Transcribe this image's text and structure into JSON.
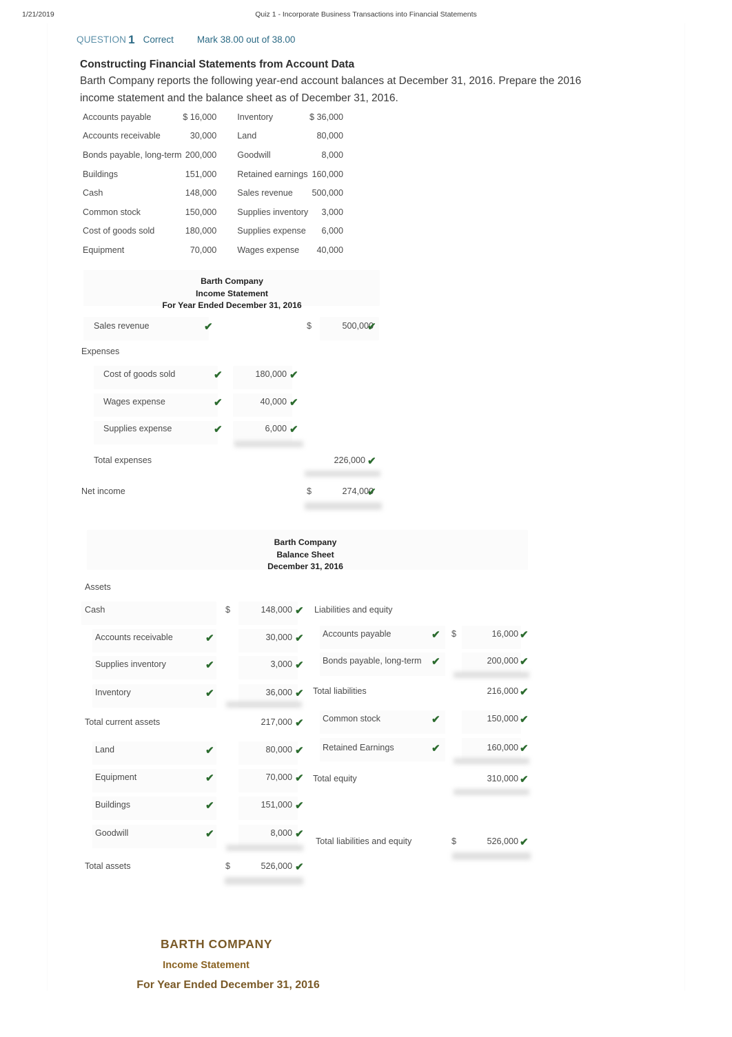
{
  "print_header": {
    "date": "1/21/2019",
    "title": "Quiz 1 - Incorporate Business Transactions into Financial Statements"
  },
  "question_meta": {
    "question_label": "QUESTION",
    "question_number": "1",
    "state": "Correct",
    "mark": "Mark 38.00 out of 38.00"
  },
  "prompt": {
    "title": "Constructing Financial Statements from Account Data",
    "body": "Barth Company reports the following year-end account balances at December 31, 2016. Prepare the 2016 income statement and the balance sheet as of December 31, 2016."
  },
  "account_data": {
    "rows": [
      {
        "label": "Accounts payable",
        "value": "$ 16,000",
        "label2": "Inventory",
        "value2": "$ 36,000"
      },
      {
        "label": "Accounts receivable",
        "value": "30,000",
        "label2": "Land",
        "value2": "80,000"
      },
      {
        "label": "Bonds payable, long-term",
        "value": "200,000",
        "label2": "Goodwill",
        "value2": "8,000"
      },
      {
        "label": "Buildings",
        "value": "151,000",
        "label2": "Retained earnings",
        "value2": "160,000"
      },
      {
        "label": "Cash",
        "value": "148,000",
        "label2": "Sales revenue",
        "value2": "500,000"
      },
      {
        "label": "Common stock",
        "value": "150,000",
        "label2": "Supplies inventory",
        "value2": "3,000"
      },
      {
        "label": "Cost of goods sold",
        "value": "180,000",
        "label2": "Supplies expense",
        "value2": "6,000"
      },
      {
        "label": "Equipment",
        "value": "70,000",
        "label2": "Wages expense",
        "value2": "40,000"
      }
    ]
  },
  "income_statement": {
    "company": "Barth Company",
    "title": "Income Statement",
    "period": "For Year Ended December 31, 2016",
    "sales_revenue_label": "Sales revenue",
    "sales_revenue_dollar": "$",
    "sales_revenue_value": "500,000",
    "expenses_header": "Expenses",
    "expense_rows": [
      {
        "label": "Cost of goods sold",
        "value": "180,000"
      },
      {
        "label": "Wages expense",
        "value": "40,000"
      },
      {
        "label": "Supplies expense",
        "value": "6,000"
      }
    ],
    "total_expenses_label": "Total expenses",
    "total_expenses_value": "226,000",
    "net_income_label": "Net income",
    "net_income_dollar": "$",
    "net_income_value": "274,000"
  },
  "balance_sheet": {
    "company": "Barth Company",
    "title": "Balance Sheet",
    "period": "December 31, 2016",
    "assets_header": "Assets",
    "cash_label": "Cash",
    "cash_dollar": "$",
    "cash_value": "148,000",
    "current_asset_rows": [
      {
        "label": "Accounts receivable",
        "value": "30,000"
      },
      {
        "label": "Supplies inventory",
        "value": "3,000"
      },
      {
        "label": "Inventory",
        "value": "36,000"
      }
    ],
    "total_current_assets_label": "Total current assets",
    "total_current_assets_value": "217,000",
    "longterm_asset_rows": [
      {
        "label": "Land",
        "value": "80,000"
      },
      {
        "label": "Equipment",
        "value": "70,000"
      },
      {
        "label": "Buildings",
        "value": "151,000"
      },
      {
        "label": "Goodwill",
        "value": "8,000"
      }
    ],
    "total_assets_label": "Total assets",
    "total_assets_dollar": "$",
    "total_assets_value": "526,000",
    "liabilities_header": "Liabilities and equity",
    "accounts_payable_label": "Accounts payable",
    "accounts_payable_dollar": "$",
    "accounts_payable_value": "16,000",
    "bonds_payable_label": "Bonds payable, long-term",
    "bonds_payable_value": "200,000",
    "total_liabilities_label": "Total liabilities",
    "total_liabilities_value": "216,000",
    "common_stock_label": "Common stock",
    "common_stock_value": "150,000",
    "retained_earnings_label": "Retained Earnings",
    "retained_earnings_value": "160,000",
    "total_equity_label": "Total equity",
    "total_equity_value": "310,000",
    "total_liab_equity_label": "Total liabilities and equity",
    "total_liab_equity_dollar": "$",
    "total_liab_equity_value": "526,000"
  },
  "gold_heading": {
    "company": "BARTH COMPANY",
    "title": "Income Statement",
    "period": "For Year Ended December 31, 2016"
  },
  "colors": {
    "tick_green": "#2b6b2e",
    "meta_blue": "#2b6a85",
    "gold": "#7a5a28"
  }
}
